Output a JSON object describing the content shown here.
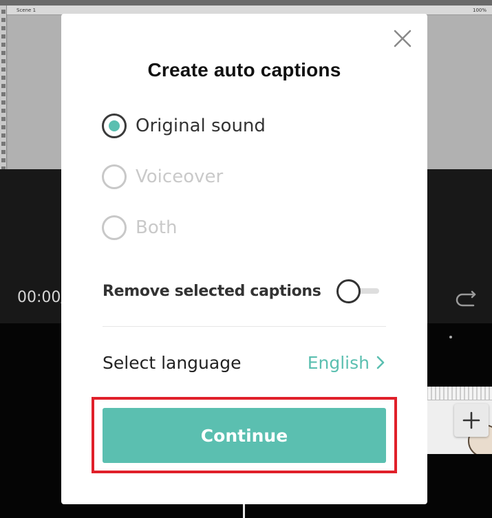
{
  "background": {
    "scene_label": "Scene 1",
    "zoom": "100%",
    "timecode": "00:00/",
    "colors": {
      "preview": "#a8a8a8",
      "dark": "#181818",
      "timeline": "#050505"
    }
  },
  "dialog": {
    "title": "Create auto captions",
    "close_icon": "close-icon",
    "audio_sources": [
      {
        "label": "Original sound",
        "selected": true,
        "enabled": true
      },
      {
        "label": "Voiceover",
        "selected": false,
        "enabled": false
      },
      {
        "label": "Both",
        "selected": false,
        "enabled": false
      }
    ],
    "remove_selected": {
      "label": "Remove selected captions",
      "on": false
    },
    "language": {
      "label": "Select language",
      "value": "English",
      "icon": "chevron-right-icon"
    },
    "continue_label": "Continue",
    "colors": {
      "accent": "#5bbfb0",
      "highlight": "#e0202a",
      "text": "#333333"
    }
  }
}
